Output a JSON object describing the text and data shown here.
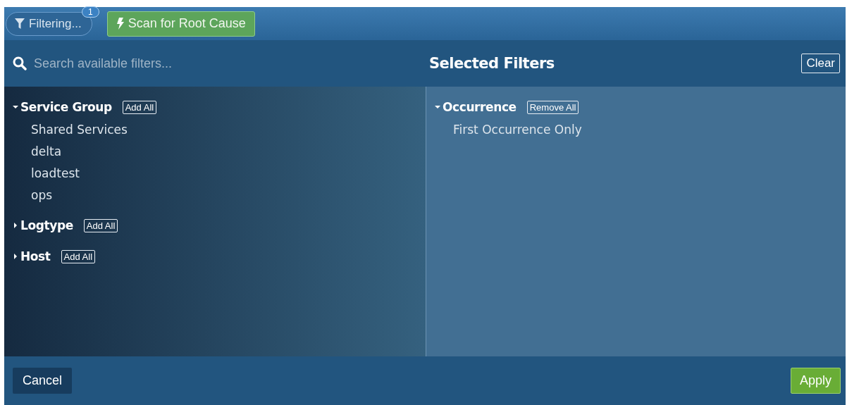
{
  "toolbar": {
    "filter_button": {
      "label": "Filtering...",
      "badge": "1"
    },
    "scan_button": {
      "label": "Scan for Root Cause"
    }
  },
  "search": {
    "placeholder": "Search available filters..."
  },
  "available_groups": [
    {
      "name": "Service Group",
      "action": "Add All",
      "expanded": true,
      "items": [
        "Shared Services",
        "delta",
        "loadtest",
        "ops"
      ]
    },
    {
      "name": "Logtype",
      "action": "Add All",
      "expanded": false
    },
    {
      "name": "Host",
      "action": "Add All",
      "expanded": false
    }
  ],
  "selected": {
    "title": "Selected Filters",
    "clear": "Clear",
    "groups": [
      {
        "name": "Occurrence",
        "action": "Remove All",
        "expanded": true,
        "items": [
          "First Occurrence Only"
        ]
      }
    ]
  },
  "footer": {
    "cancel": "Cancel",
    "apply": "Apply"
  }
}
